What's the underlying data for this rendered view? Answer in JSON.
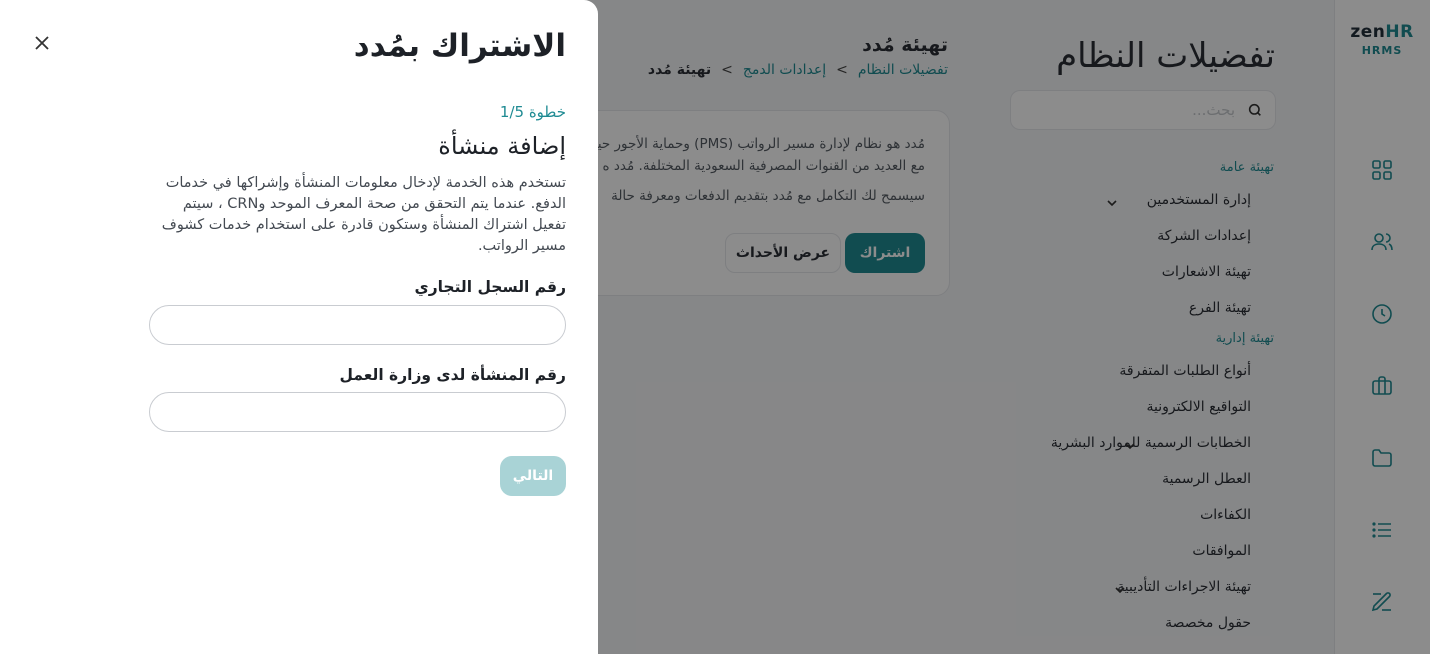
{
  "app": {
    "logo_zen": "zen",
    "logo_hr": "HR",
    "logo_product": "HRMS",
    "rail_icons": [
      "dashboard-icon",
      "users-icon",
      "clock-icon",
      "briefcase-icon",
      "folder-icon",
      "list-icon",
      "edit-icon"
    ]
  },
  "settings": {
    "title": "تفضيلات النظام",
    "search_placeholder": "بحث..."
  },
  "nav": {
    "section_general": "تهيئة عامة",
    "items_general": [
      "إدارة المستخدمين",
      "إعدادات الشركة",
      "تهيئة الاشعارات",
      "تهيئة الفرع"
    ],
    "section_admin": "تهيئة إدارية",
    "items_admin": [
      "أنواع الطلبات المتفرقة",
      "التواقيع الالكترونية",
      "الخطابات الرسمية للموارد البشرية",
      "العطل الرسمية",
      "الكفاءات",
      "الموافقات",
      "تهيئة الاجراءات التأديبية",
      "حقول مخصصة"
    ]
  },
  "page": {
    "title": "تهيئة مُدد",
    "breadcrumb": [
      "تفضيلات النظام",
      "إعدادات الدمج",
      "تهيئة مُدد"
    ],
    "breadcrumb_sep": ">"
  },
  "card": {
    "line1": "مُدد هو نظام لإدارة مسير الرواتب (PMS) وحماية الأجور حيث",
    "line2": "مع العديد من القنوات المصرفية السعودية المختلفة. مُدد ه",
    "line3": "سيسمح لك التكامل مع مُدد بتقديم الدفعات ومعرفة حالة",
    "subscribe_button": "اشتراك",
    "events_button": "عرض الأحداث"
  },
  "modal": {
    "title": "الاشتراك بمُدد",
    "step": "خطوة 1/5",
    "subtitle": "إضافة منشأة",
    "description": "تستخدم هذه الخدمة لإدخال معلومات المنشأة وإشراكها في خدمات الدفع. عندما يتم التحقق من صحة المعرف الموحد وCRN ، سيتم تفعيل اشتراك المنشأة وستكون قادرة على استخدام خدمات كشوف مسير الرواتب.",
    "cr_label": "رقم السجل التجاري",
    "cr_value": "",
    "mol_label": "رقم المنشأة لدى وزارة العمل",
    "mol_value": "",
    "next_button": "التالي"
  },
  "colors": {
    "brand": "#1f8b93",
    "next_disabled": "#a9d3d6"
  }
}
